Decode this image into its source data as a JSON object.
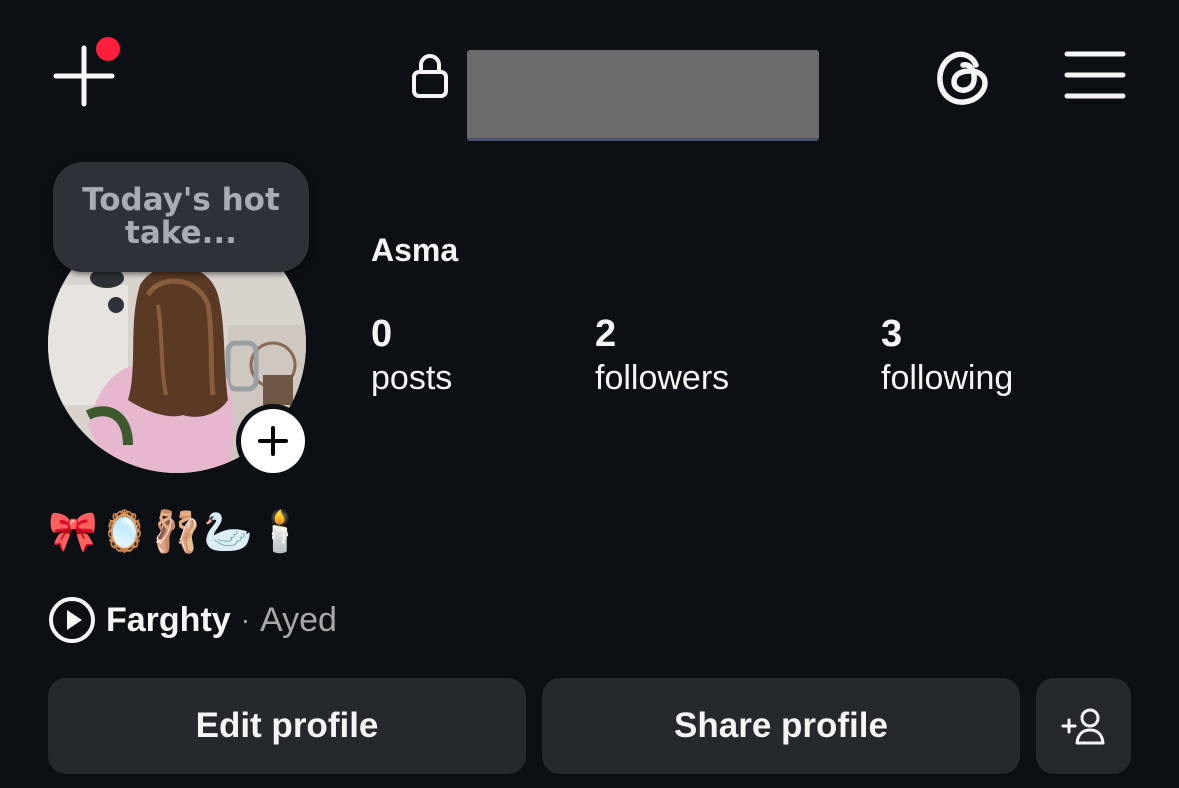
{
  "header": {
    "create_icon": "plus-icon",
    "notification_dot_color": "#ff1e3c",
    "lock_icon": "lock-icon",
    "threads_icon": "threads-icon",
    "menu_icon": "hamburger-menu-icon"
  },
  "profile": {
    "note": "Today's hot take...",
    "name": "Asma",
    "bio": "🎀🪞🩰🦢🕯️",
    "stats": [
      {
        "value": "0",
        "label": "posts"
      },
      {
        "value": "2",
        "label": "followers"
      },
      {
        "value": "3",
        "label": "following"
      }
    ],
    "music": {
      "title": "Farghty",
      "separator": "·",
      "artist": "Ayed"
    }
  },
  "actions": {
    "edit_label": "Edit profile",
    "share_label": "Share profile",
    "add_person_icon": "add-person-icon"
  },
  "colors": {
    "background": "#0c1014",
    "button_bg": "#25292e",
    "text": "#f5f5f5",
    "muted": "#a8a8a8"
  }
}
